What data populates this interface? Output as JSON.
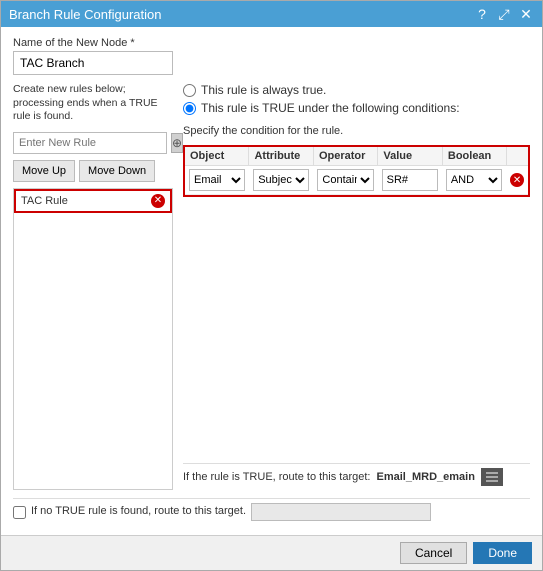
{
  "dialog": {
    "title": "Branch Rule Configuration",
    "icons": {
      "help": "?",
      "expand": "⤢",
      "close": "✕"
    }
  },
  "form": {
    "node_name_label": "Name of the New Node *",
    "node_name_value": "TAC Branch",
    "rules_section_label": "Create new rules below; processing ends when a TRUE rule is found.",
    "new_rule_placeholder": "Enter New Rule",
    "move_up_label": "Move Up",
    "move_down_label": "Move Down",
    "radio_options": [
      {
        "id": "r1",
        "label": "This rule is always true.",
        "checked": false
      },
      {
        "id": "r2",
        "label": "This rule is TRUE under the following conditions:",
        "checked": true
      }
    ],
    "condition_label": "Specify the condition for the rule.",
    "table": {
      "headers": [
        "Object",
        "Attribute",
        "Operator",
        "Value",
        "Boolean"
      ],
      "rows": [
        {
          "object": "Email",
          "attribute": "Subject",
          "operator": "Contains",
          "value": "SR#",
          "boolean": "AND"
        }
      ]
    },
    "rule_item": "TAC Rule",
    "route_label": "If the rule is TRUE, route to this target:",
    "route_value": "Email_MRD_emain",
    "no_true_label": "If no TRUE rule is found, route to this target.",
    "cancel_label": "Cancel",
    "done_label": "Done"
  }
}
